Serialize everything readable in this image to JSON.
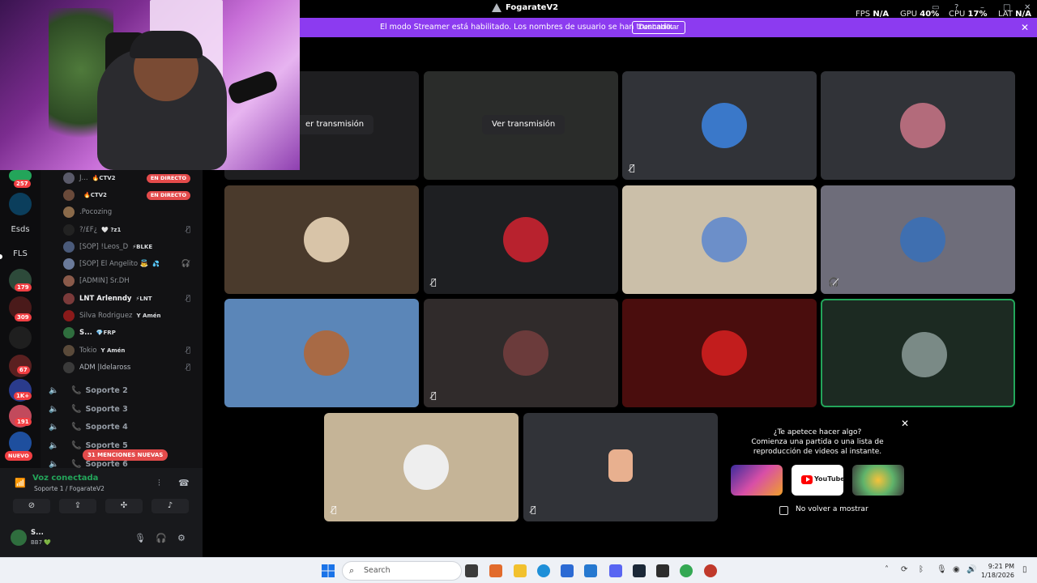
{
  "titlebar": {
    "title": "FogarateV2",
    "fps_label": "FPS",
    "fps_value": "N/A",
    "gpu_label": "GPU",
    "gpu_value": "40%",
    "cpu_label": "CPU",
    "cpu_value": "17%",
    "lat_label": "LAT",
    "lat_value": "N/A"
  },
  "banner": {
    "text": "El modo Streamer está habilitado. Los nombres de usuario se han truncado.",
    "button": "Deshabilitar",
    "close": "✕"
  },
  "rail": {
    "badges": [
      "257",
      "179",
      "309",
      "67",
      "1K+",
      "191"
    ],
    "text_servers": [
      "Esds",
      "FLS"
    ],
    "nuevo": "NUEVO"
  },
  "channels": {
    "members": [
      {
        "name": "J...",
        "tag": "🔥CTV2",
        "live": "EN DIRECTO",
        "bright": false
      },
      {
        "name": "",
        "tag": "🔥CTV2",
        "live": "EN DIRECTO",
        "bright": false
      },
      {
        "name": ".Pocozing",
        "tag": "",
        "live": "",
        "bright": false
      },
      {
        "name": "?/£F¿",
        "tag": "🤍 ?z1",
        "live": "",
        "bright": false
      },
      {
        "name": "[SOP] !Leos_D",
        "tag": "⚡BLKE",
        "live": "",
        "bright": false
      },
      {
        "name": "[SOP] El Angelito 👼",
        "tag": "💦",
        "live": "",
        "bright": false
      },
      {
        "name": "[ADMIN] Sr.DH",
        "tag": "",
        "live": "",
        "bright": false
      },
      {
        "name": "LNT Arlenndy",
        "tag": "⚡LNT",
        "live": "",
        "bright": true
      },
      {
        "name": "Silva Rodriguez",
        "tag": "Y Amén",
        "live": "",
        "bright": false
      },
      {
        "name": "S...",
        "tag": "💎FRP",
        "live": "",
        "bright": true
      },
      {
        "name": "Tokio",
        "tag": "Y Amén",
        "live": "",
        "bright": false
      },
      {
        "name": "ADM |Idelaross",
        "tag": "",
        "live": "",
        "bright": false
      }
    ],
    "voice_channels": [
      "Soporte 2",
      "Soporte 3",
      "Soporte 4",
      "Soporte 5",
      "Soporte 6"
    ],
    "mentions": "31 MENCIONES NUEVAS"
  },
  "voice_panel": {
    "status": "Voz conectada",
    "channel": "Soporte 1 / FogarateV2",
    "user_name": "S...",
    "user_status": "BB7 💚"
  },
  "stage": {
    "watch_stream": "Ver transmisión",
    "watch_stream_cut": "er transmisión"
  },
  "activity": {
    "title_line1": "¿Te apetece hacer algo?",
    "title_line2": "Comienza una partida o una lista de",
    "title_line3": "reproducción de videos al instante.",
    "youtube_label": "YouTube",
    "dont_show": "No volver a mostrar",
    "close": "✕"
  },
  "taskbar": {
    "search_placeholder": "Search",
    "time": "9:21 PM",
    "date": "1/18/2026"
  },
  "colors": {
    "accent_purple": "#8c3bf0",
    "live_red": "#e34b4b",
    "voice_green": "#23a55a"
  }
}
